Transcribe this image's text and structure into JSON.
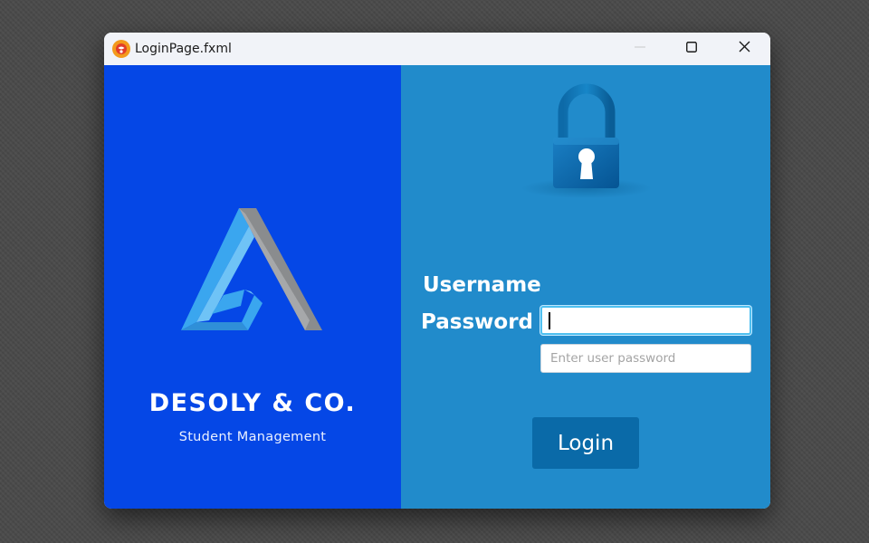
{
  "window": {
    "title": "LoginPage.fxml",
    "app_icon": "scene-builder-icon",
    "controls": {
      "minimize_icon": "minimize-icon",
      "maximize_icon": "maximize-icon",
      "close_icon": "close-icon"
    }
  },
  "branding": {
    "logo_icon": "triangle-logo-icon",
    "company_name": "DESOLY & CO.",
    "tagline": "Student Management"
  },
  "login": {
    "lock_icon": "padlock-icon",
    "username_label": "Username",
    "username_value": "",
    "password_label": "Password",
    "password_placeholder": "Enter user password",
    "login_button": "Login"
  },
  "colors": {
    "left_panel": "#0547e6",
    "right_panel": "#218bcb",
    "login_button": "#0a6aa8",
    "logo_blue": "#3aa6ef",
    "logo_gray": "#8a8c8e"
  }
}
